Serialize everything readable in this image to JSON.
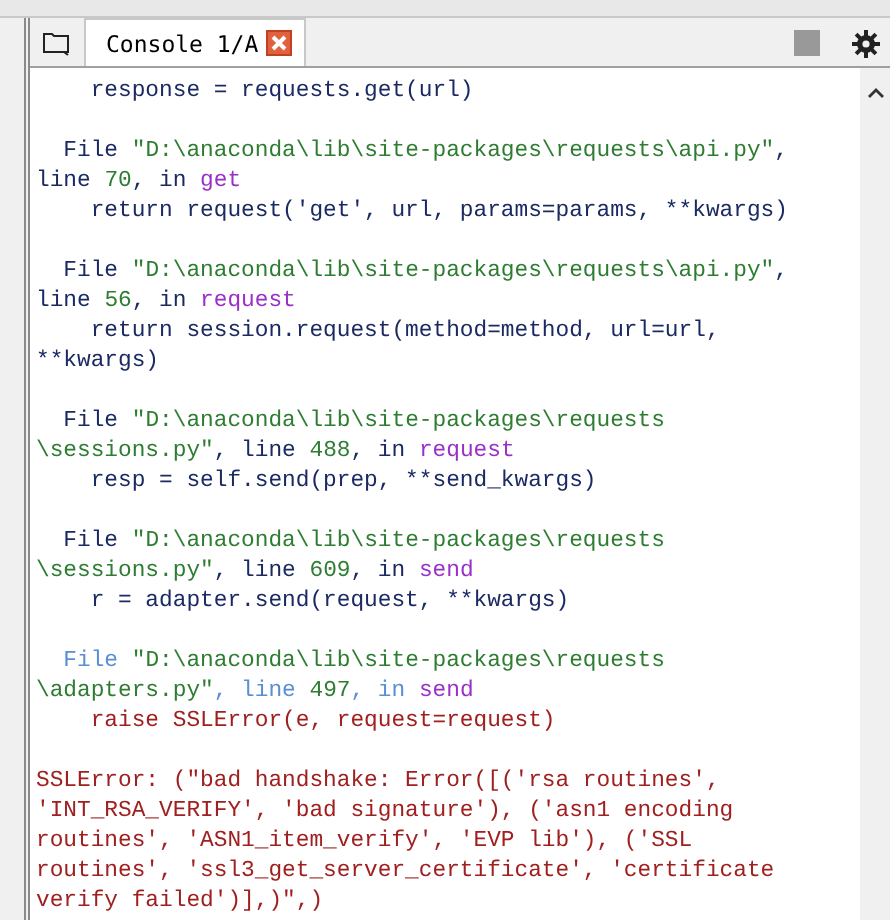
{
  "tabs": [
    {
      "label": "Console 1/A",
      "selected": true
    }
  ],
  "console": {
    "blocks": [
      [
        [
          {
            "kind": "code",
            "text": "    response = requests.get(url)"
          }
        ]
      ],
      [
        [
          {
            "kind": "code",
            "text": "  File "
          },
          {
            "kind": "path",
            "text": "\"D:\\anaconda\\lib\\site-packages\\requests\\api.py\""
          },
          {
            "kind": "code",
            "text": ","
          }
        ],
        [
          {
            "kind": "code",
            "text": "line "
          },
          {
            "kind": "path",
            "text": "70"
          },
          {
            "kind": "code",
            "text": ", in "
          },
          {
            "kind": "func",
            "text": "get"
          }
        ],
        [
          {
            "kind": "code",
            "text": "    return request('get', url, params=params, **kwargs)"
          }
        ]
      ],
      [
        [
          {
            "kind": "code",
            "text": "  File "
          },
          {
            "kind": "path",
            "text": "\"D:\\anaconda\\lib\\site-packages\\requests\\api.py\""
          },
          {
            "kind": "code",
            "text": ","
          }
        ],
        [
          {
            "kind": "code",
            "text": "line "
          },
          {
            "kind": "path",
            "text": "56"
          },
          {
            "kind": "code",
            "text": ", in "
          },
          {
            "kind": "func",
            "text": "request"
          }
        ],
        [
          {
            "kind": "code",
            "text": "    return session.request(method=method, url=url,"
          }
        ],
        [
          {
            "kind": "code",
            "text": "**kwargs)"
          }
        ]
      ],
      [
        [
          {
            "kind": "code",
            "text": "  File "
          },
          {
            "kind": "path",
            "text": "\"D:\\anaconda\\lib\\site-packages\\requests"
          }
        ],
        [
          {
            "kind": "path",
            "text": "\\sessions.py\""
          },
          {
            "kind": "code",
            "text": ", line "
          },
          {
            "kind": "path",
            "text": "488"
          },
          {
            "kind": "code",
            "text": ", in "
          },
          {
            "kind": "func",
            "text": "request"
          }
        ],
        [
          {
            "kind": "code",
            "text": "    resp = self.send(prep, **send_kwargs)"
          }
        ]
      ],
      [
        [
          {
            "kind": "code",
            "text": "  File "
          },
          {
            "kind": "path",
            "text": "\"D:\\anaconda\\lib\\site-packages\\requests"
          }
        ],
        [
          {
            "kind": "path",
            "text": "\\sessions.py\""
          },
          {
            "kind": "code",
            "text": ", line "
          },
          {
            "kind": "path",
            "text": "609"
          },
          {
            "kind": "code",
            "text": ", in "
          },
          {
            "kind": "func",
            "text": "send"
          }
        ],
        [
          {
            "kind": "code",
            "text": "    r = adapter.send(request, **kwargs)"
          }
        ]
      ],
      [
        [
          {
            "kind": "faint",
            "text": "  File "
          },
          {
            "kind": "path",
            "text": "\"D:\\anaconda\\lib\\site-packages\\requests"
          }
        ],
        [
          {
            "kind": "path",
            "text": "\\adapters.py\""
          },
          {
            "kind": "faint",
            "text": ", line "
          },
          {
            "kind": "path",
            "text": "497"
          },
          {
            "kind": "faint",
            "text": ", in "
          },
          {
            "kind": "func",
            "text": "send"
          }
        ],
        [
          {
            "kind": "error",
            "text": "    raise SSLError(e, request=request)"
          }
        ]
      ],
      [
        [
          {
            "kind": "error",
            "text": "SSLError: (\"bad handshake: Error([('rsa routines',"
          }
        ],
        [
          {
            "kind": "error",
            "text": "'INT_RSA_VERIFY', 'bad signature'), ('asn1 encoding"
          }
        ],
        [
          {
            "kind": "error",
            "text": "routines', 'ASN1_item_verify', 'EVP lib'), ('SSL"
          }
        ],
        [
          {
            "kind": "error",
            "text": "routines', 'ssl3_get_server_certificate', 'certificate"
          }
        ],
        [
          {
            "kind": "error",
            "text": "verify failed')],)\",)"
          }
        ]
      ]
    ]
  }
}
